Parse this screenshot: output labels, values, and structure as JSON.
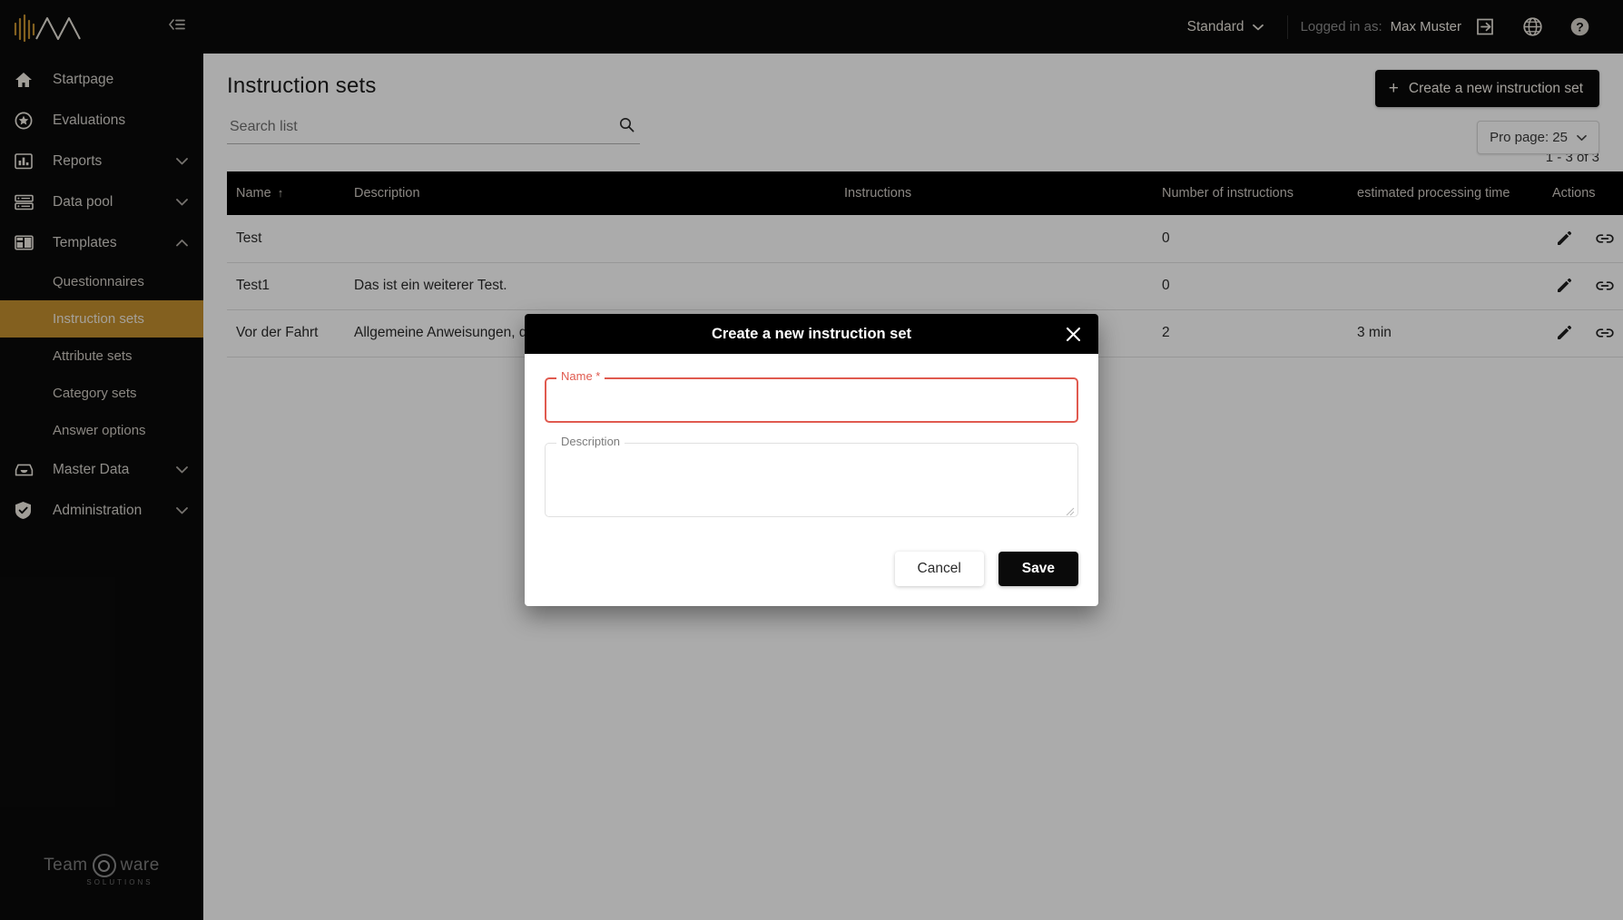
{
  "brand": {
    "logo_icon": "waveform-peaks-logo",
    "collapse_icon": "collapse-sidebar-icon"
  },
  "sidebar": {
    "items": [
      {
        "label": "Startpage",
        "icon": "home-icon",
        "expandable": false,
        "expanded": false
      },
      {
        "label": "Evaluations",
        "icon": "star-circle-icon",
        "expandable": false,
        "expanded": false
      },
      {
        "label": "Reports",
        "icon": "bar-chart-icon",
        "expandable": true,
        "expanded": false
      },
      {
        "label": "Data pool",
        "icon": "database-list-icon",
        "expandable": true,
        "expanded": false
      },
      {
        "label": "Templates",
        "icon": "templates-icon",
        "expandable": true,
        "expanded": true
      }
    ],
    "sub_items": [
      {
        "label": "Questionnaires",
        "active": false
      },
      {
        "label": "Instruction sets",
        "active": true
      },
      {
        "label": "Attribute sets",
        "active": false
      },
      {
        "label": "Category sets",
        "active": false
      },
      {
        "label": "Answer options",
        "active": false
      }
    ],
    "items_after": [
      {
        "label": "Master Data",
        "icon": "inbox-icon",
        "expandable": true,
        "expanded": false
      },
      {
        "label": "Administration",
        "icon": "shield-check-icon",
        "expandable": true,
        "expanded": false
      }
    ],
    "footer_logo": {
      "part1": "Team",
      "part2": "ware",
      "tagline": "SOLUTIONS"
    }
  },
  "topbar": {
    "standard_label": "Standard",
    "logged_in_label": "Logged in as:",
    "user_name": "Max Muster",
    "icons": [
      {
        "name": "logout-icon"
      },
      {
        "name": "globe-language-icon"
      },
      {
        "name": "help-circle-icon"
      }
    ]
  },
  "page": {
    "title": "Instruction sets",
    "search_placeholder": "Search list",
    "search_value": "",
    "create_button": "Create a new instruction set",
    "per_page_label": "Pro page: 25",
    "range_label": "1 - 3 of 3"
  },
  "table": {
    "columns": [
      "Name",
      "Description",
      "Instructions",
      "Number of instructions",
      "estimated processing time",
      "Actions"
    ],
    "sort_column": "Name",
    "sort_direction": "asc",
    "rows": [
      {
        "name": "Test",
        "description": "",
        "instructions": "",
        "number_of_instructions": "0",
        "estimated_processing_time": "",
        "actions": [
          "edit-pencil-icon",
          "link-chain-icon"
        ]
      },
      {
        "name": "Test1",
        "description": "Das ist ein weiterer Test.",
        "instructions": "",
        "number_of_instructions": "0",
        "estimated_processing_time": "",
        "actions": [
          "edit-pencil-icon",
          "link-chain-icon"
        ]
      },
      {
        "name": "Vor der Fahrt",
        "description": "Allgemeine Anweisungen, die n",
        "instructions": "",
        "number_of_instructions": "2",
        "estimated_processing_time": "3 min",
        "actions": [
          "edit-pencil-icon",
          "link-chain-icon"
        ]
      }
    ]
  },
  "modal": {
    "title": "Create a new instruction set",
    "close_icon": "close-x-icon",
    "name_field": {
      "label": "Name *",
      "value": "",
      "state": "error"
    },
    "description_field": {
      "label": "Description",
      "value": ""
    },
    "cancel_button": "Cancel",
    "save_button": "Save"
  },
  "colors": {
    "accent_gold": "#c3902f",
    "surface_dark": "#0a0a0a",
    "error_red": "#e05a4f",
    "backdrop": "rgba(0,0,0,0.33)"
  }
}
